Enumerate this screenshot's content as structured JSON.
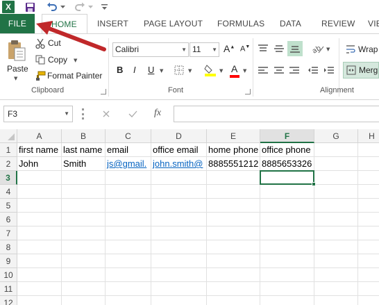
{
  "app": {
    "logo_letter": "X",
    "accent": "#217346",
    "annotation_color": "#c0282a"
  },
  "qat": {
    "save_icon": "save-icon",
    "undo_icon": "undo-icon",
    "redo_icon": "redo-icon",
    "customize_icon": "customize-qat-icon"
  },
  "tabs": [
    {
      "label": "FILE"
    },
    {
      "label": "HOME"
    },
    {
      "label": "INSERT"
    },
    {
      "label": "PAGE LAYOUT"
    },
    {
      "label": "FORMULAS"
    },
    {
      "label": "DATA"
    },
    {
      "label": "REVIEW"
    },
    {
      "label": "VIE"
    }
  ],
  "ribbon": {
    "clipboard": {
      "paste_label": "Paste",
      "cut_label": "Cut",
      "copy_label": "Copy",
      "format_painter_label": "Format Painter",
      "group_label": "Clipboard"
    },
    "font": {
      "font_name": "Calibri",
      "font_size": "11",
      "bold": "B",
      "italic": "I",
      "underline": "U",
      "font_color_letter": "A",
      "grow_letter": "A",
      "shrink_letter": "A",
      "group_label": "Font",
      "highlight_color": "#ffff00",
      "font_color": "#ff0000"
    },
    "alignment": {
      "wrap_label": "Wrap",
      "merge_label": "Merg",
      "group_label": "Alignment"
    }
  },
  "formula_bar": {
    "name_box": "F3",
    "fx_label": "fx",
    "cancel_icon": "cancel-icon",
    "enter_icon": "enter-icon",
    "formula": ""
  },
  "sheet": {
    "columns": [
      "A",
      "B",
      "C",
      "D",
      "E",
      "F",
      "G",
      "H"
    ],
    "rows": [
      "1",
      "2",
      "3",
      "4",
      "5",
      "6",
      "7",
      "8",
      "9",
      "10",
      "11",
      "12"
    ],
    "selected_cell": "F3",
    "row1": [
      "first name",
      "last name",
      "email",
      "office email",
      "home phone",
      "office phone",
      "",
      ""
    ],
    "row2": [
      "John",
      "Smith",
      "js@gmail.",
      "john.smith@",
      "8885551212",
      "8885653326",
      "",
      ""
    ]
  }
}
